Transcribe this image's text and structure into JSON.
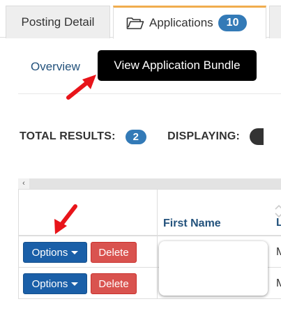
{
  "tabs": {
    "posting_detail": "Posting Detail",
    "applications": "Applications",
    "applications_count": "10"
  },
  "subnav": {
    "overview": "Overview",
    "tooltip": "View Application Bundle"
  },
  "results": {
    "total_label": "TOTAL RESULTS:",
    "total_count": "2",
    "displaying_label": "DISPLAYING:"
  },
  "scroll": {
    "left_arrow": "‹"
  },
  "table": {
    "headers": {
      "first_name": "First Name",
      "last_name": "L"
    },
    "rows": [
      {
        "options": "Options",
        "delete": "Delete",
        "last": "M"
      },
      {
        "options": "Options",
        "delete": "Delete",
        "last": "M"
      }
    ]
  },
  "colors": {
    "primary": "#1a5fa8",
    "danger": "#d9534f",
    "badge": "#337ab7",
    "tab_accent": "#f0ad4e",
    "arrow": "#e8141a"
  },
  "icons": {
    "tab": "folder-open-icon",
    "sort": "sort-icon",
    "annotation": "red-arrow-icon"
  }
}
